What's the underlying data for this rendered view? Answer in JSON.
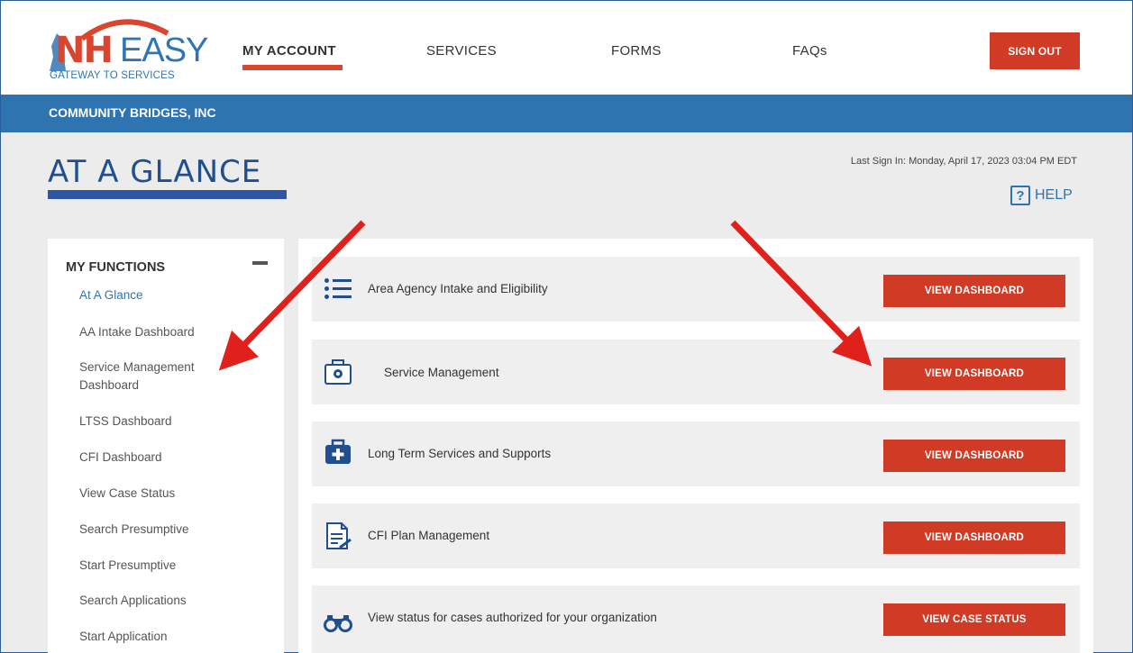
{
  "logo": {
    "nh": "NH",
    "easy": "EASY",
    "tagline": "GATEWAY TO SERVICES"
  },
  "nav": {
    "items": [
      "MY ACCOUNT",
      "SERVICES",
      "FORMS",
      "FAQs"
    ],
    "active": "MY ACCOUNT",
    "sign_out": "SIGN OUT"
  },
  "org": {
    "name": "COMMUNITY BRIDGES, INC"
  },
  "page": {
    "title": "AT A GLANCE",
    "last_sign_in": "Last Sign In: Monday, April 17, 2023 03:04 PM EDT",
    "help": "HELP",
    "help_icon": "?"
  },
  "sidebar": {
    "heading": "MY FUNCTIONS",
    "items": [
      "At A Glance",
      "AA Intake Dashboard",
      "Service Management Dashboard",
      "LTSS Dashboard",
      "CFI Dashboard",
      "View Case Status",
      "Search Presumptive",
      "Start Presumptive",
      "Search Applications",
      "Start Application"
    ],
    "active": "At A Glance"
  },
  "cards": [
    {
      "icon": "list-icon",
      "label": "Area Agency Intake and Eligibility",
      "button": "VIEW DASHBOARD"
    },
    {
      "icon": "medical-kit-outline-icon",
      "label": "Service Management",
      "button": "VIEW DASHBOARD"
    },
    {
      "icon": "medical-kit-icon",
      "label": "Long Term Services and Supports",
      "button": "VIEW DASHBOARD"
    },
    {
      "icon": "document-edit-icon",
      "label": "CFI Plan Management",
      "button": "VIEW DASHBOARD"
    },
    {
      "icon": "binoculars-icon",
      "label": "View status for cases authorized for your organization",
      "button": "VIEW CASE STATUS"
    }
  ],
  "colors": {
    "accent_red": "#d13b25",
    "brand_blue": "#2e74b0",
    "annotation_arrow": "#e0201a"
  }
}
